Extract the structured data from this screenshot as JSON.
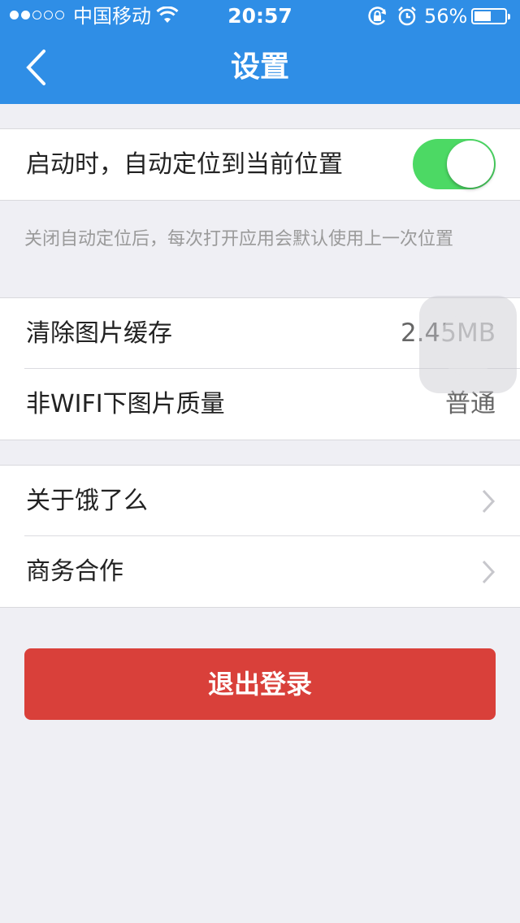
{
  "status_bar": {
    "signal_bars": 2,
    "signal_total": 5,
    "carrier": "中国移动",
    "time": "20:57",
    "battery_percent": "56%",
    "battery_level": 0.56
  },
  "nav": {
    "title": "设置",
    "back_icon": "chevron-left-icon"
  },
  "location": {
    "label": "启动时，自动定位到当前位置",
    "toggle_on": true,
    "note": "关闭自动定位后，每次打开应用会默认使用上一次位置"
  },
  "media": {
    "clear_cache_label": "清除图片缓存",
    "cache_size": "2.45MB",
    "image_quality_label": "非WIFI下图片质量",
    "image_quality_value": "普通"
  },
  "info": {
    "about_label": "关于饿了么",
    "business_label": "商务合作"
  },
  "logout_label": "退出登录",
  "colors": {
    "nav_bg": "#2f8ee6",
    "toggle_on": "#4cd964",
    "logout_bg": "#d9403a",
    "page_bg": "#efeff4"
  }
}
